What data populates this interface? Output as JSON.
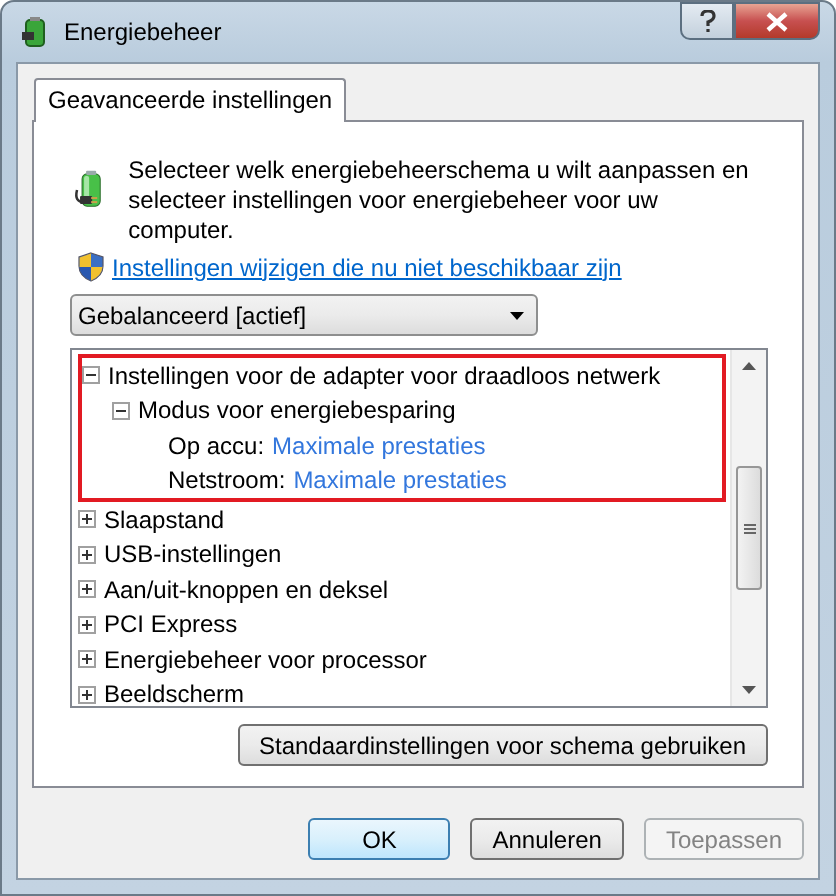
{
  "window": {
    "title": "Energiebeheer"
  },
  "tabs": [
    {
      "label": "Geavanceerde instellingen",
      "selected": true
    }
  ],
  "intro": "Selecteer welk energiebeheerschema u wilt aanpassen en selecteer instellingen voor energiebeheer voor uw computer.",
  "admin_link": "Instellingen wijzigen die nu niet beschikbaar zijn",
  "plan_select": {
    "value": "Gebalanceerd [actief]"
  },
  "tree": [
    {
      "kind": "group",
      "label": "Instellingen voor de adapter voor draadloos netwerk",
      "expanded": true,
      "highlighted": true,
      "children": [
        {
          "kind": "group",
          "label": "Modus voor energiebesparing",
          "expanded": true,
          "children": [
            {
              "kind": "setting",
              "label": "Op accu:",
              "value": "Maximale prestaties"
            },
            {
              "kind": "setting",
              "label": "Netstroom:",
              "value": "Maximale prestaties"
            }
          ]
        }
      ]
    },
    {
      "kind": "group",
      "label": "Slaapstand",
      "expanded": false,
      "highlighted": false
    },
    {
      "kind": "group",
      "label": "USB-instellingen",
      "expanded": false,
      "highlighted": false
    },
    {
      "kind": "group",
      "label": "Aan/uit-knoppen en deksel",
      "expanded": false,
      "highlighted": false
    },
    {
      "kind": "group",
      "label": "PCI Express",
      "expanded": false,
      "highlighted": false
    },
    {
      "kind": "group",
      "label": "Energiebeheer voor processor",
      "expanded": false,
      "highlighted": false
    },
    {
      "kind": "group",
      "label": "Beeldscherm",
      "expanded": false,
      "highlighted": false
    }
  ],
  "restore_button": "Standaardinstellingen voor schema gebruiken",
  "buttons": [
    {
      "label": "OK",
      "default": true,
      "disabled": false
    },
    {
      "label": "Annuleren",
      "default": false,
      "disabled": false
    },
    {
      "label": "Toepassen",
      "default": false,
      "disabled": true
    }
  ]
}
